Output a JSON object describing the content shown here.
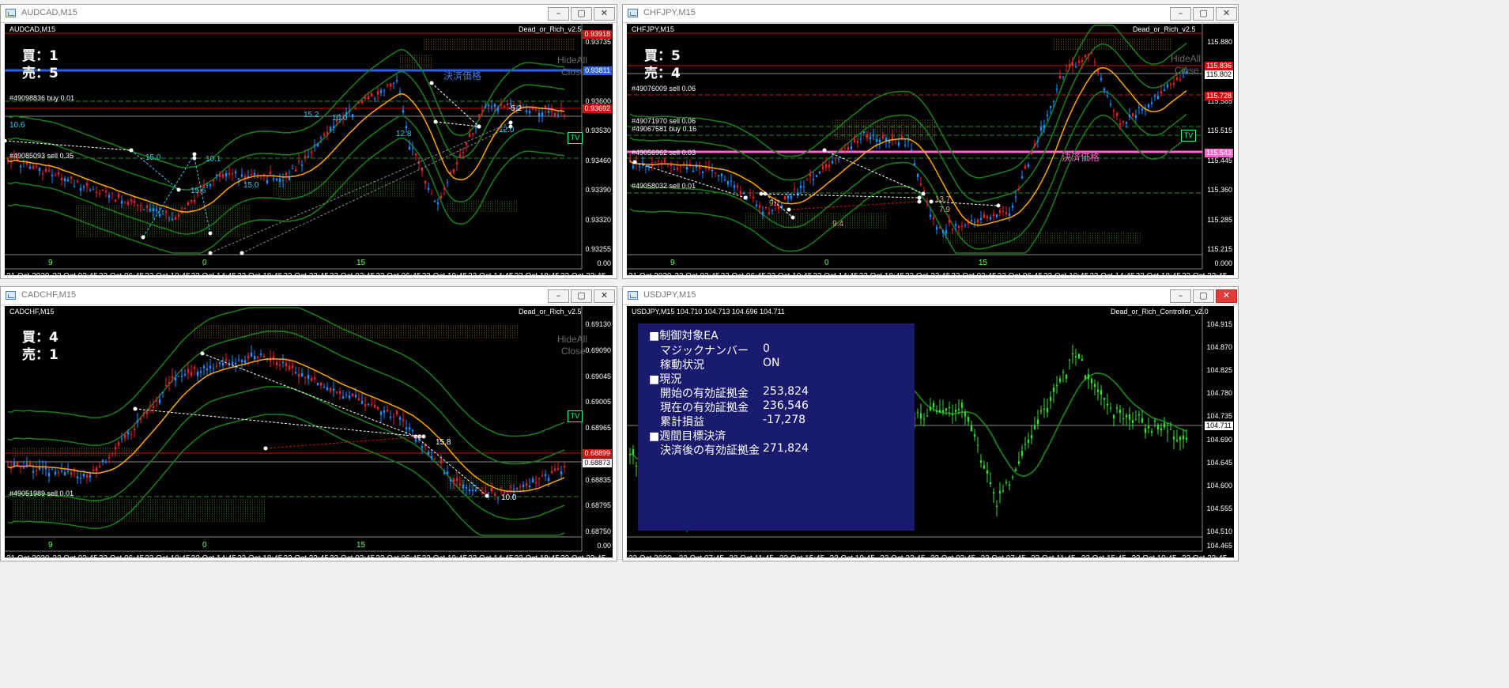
{
  "windows": [
    {
      "title": "AUDCAD,M15",
      "symbol_label": "AUDCAD,M15",
      "ea_label": "Dead_or_Rich_v2.5",
      "buy_label": "買：1",
      "sell_label": "売：5",
      "hideall": "HideAll",
      "close": "Close",
      "tv": "TV",
      "settle_label": "決済価格",
      "orders": [
        "#49098836 buy 0.01",
        "#49085093 sell 0.35"
      ],
      "prices": [
        "0.93735",
        "0.93670",
        "0.93600",
        "0.93530",
        "0.93460",
        "0.93390",
        "0.93320",
        "0.93255",
        "0.00"
      ],
      "price_boxes": [
        "0.93918",
        "0.93811",
        "0.93692"
      ],
      "time_labels": [
        "21 Oct 2020",
        "22 Oct 02:45",
        "22 Oct 06:45",
        "22 Oct 10:45",
        "22 Oct 14:45",
        "22 Oct 18:45",
        "22 Oct 22:45",
        "23 Oct 02:45",
        "23 Oct 06:45",
        "23 Oct 10:45",
        "23 Oct 14:45",
        "23 Oct 18:45",
        "23 Oct 22:45"
      ],
      "day_labels": [
        "9",
        "0",
        "15"
      ],
      "tags": [
        "10.6",
        "15.0",
        "10.1",
        "15.6",
        "15.0",
        "15.2",
        "10.0",
        "12.8",
        "-5.2",
        "12.0"
      ]
    },
    {
      "title": "CHFJPY,M15",
      "symbol_label": "CHFJPY,M15",
      "ea_label": "Dead_or_Rich_v2.5",
      "buy_label": "買：5",
      "sell_label": "売：4",
      "hideall": "HideAll",
      "close": "Close",
      "tv": "TV",
      "settle_label": "決済価格",
      "orders": [
        "#49076009 sell 0.06",
        "#49071970 sell 0.06",
        "#49067581 buy 0.16",
        "#49056962 sell 0.03",
        "#49058032 sell 0.01"
      ],
      "prices": [
        "115.880",
        "115.655",
        "115.585",
        "115.515",
        "115.445",
        "115.360",
        "115.285",
        "115.215",
        "0.000"
      ],
      "price_boxes": [
        "115.836",
        "115.802",
        "115.728",
        "115.543"
      ],
      "time_labels": [
        "21 Oct 2020",
        "22 Oct 02:45",
        "22 Oct 06:45",
        "22 Oct 10:45",
        "22 Oct 14:45",
        "22 Oct 18:45",
        "22 Oct 22:45",
        "23 Oct 02:45",
        "23 Oct 06:45",
        "23 Oct 10:45",
        "23 Oct 14:45",
        "23 Oct 18:45",
        "23 Oct 22:45"
      ],
      "day_labels": [
        "9",
        "0",
        "15"
      ],
      "tags": [
        "9.7",
        "9.4",
        "13.7",
        "7.9"
      ]
    },
    {
      "title": "CADCHF,M15",
      "symbol_label": "CADCHF,M15",
      "ea_label": "Dead_or_Rich_v2.5",
      "buy_label": "買：4",
      "sell_label": "売：1",
      "hideall": "HideAll",
      "close": "Close",
      "tv": "TV",
      "orders": [
        "#49051989 sell 0.01"
      ],
      "prices": [
        "0.69130",
        "0.69090",
        "0.69045",
        "0.69005",
        "0.68965",
        "0.68920",
        "0.68835",
        "0.68795",
        "0.68750",
        "0.00"
      ],
      "price_boxes": [
        "0.68899",
        "0.68873"
      ],
      "time_labels": [
        "21 Oct 2020",
        "22 Oct 02:45",
        "22 Oct 06:45",
        "22 Oct 10:45",
        "22 Oct 14:45",
        "22 Oct 18:45",
        "22 Oct 22:45",
        "23 Oct 02:45",
        "23 Oct 06:45",
        "23 Oct 10:45",
        "23 Oct 14:45",
        "23 Oct 18:45",
        "23 Oct 22:45"
      ],
      "day_labels": [
        "9",
        "0",
        "15"
      ],
      "tags": [
        "15.8",
        "10.0"
      ]
    },
    {
      "title": "USDJPY,M15",
      "symbol_label": "USDJPY,M15  104.710 104.713 104.696 104.711",
      "ea_label": "Dead_or_Rich_Controller_v2.0",
      "prices": [
        "104.915",
        "104.870",
        "104.825",
        "104.780",
        "104.735",
        "104.690",
        "104.645",
        "104.600",
        "104.555",
        "104.510",
        "104.465"
      ],
      "price_boxes": [
        "104.711"
      ],
      "time_labels": [
        "22 Oct 2020",
        "22 Oct 07:45",
        "22 Oct 11:45",
        "22 Oct 15:45",
        "22 Oct 19:45",
        "22 Oct 23:45",
        "23 Oct 03:45",
        "23 Oct 07:45",
        "23 Oct 11:45",
        "23 Oct 15:45",
        "23 Oct 19:45",
        "23 Oct 23:45"
      ],
      "controller": {
        "h1": "■制御対象EA",
        "magic_label": "マジックナンバー",
        "magic_value": "0",
        "status_label": "稼動状況",
        "status_value": "ON",
        "h2": "■現況",
        "start_label": "開始の有効証拠金",
        "start_value": "253,824",
        "current_label": "現在の有効証拠金",
        "current_value": "236,546",
        "pl_label": "累計損益",
        "pl_value": "-17,278",
        "h3": "■週間目標決済",
        "after_label": "決済後の有効証拠金",
        "after_value": "271,824"
      }
    }
  ],
  "colors": {
    "bull": "#1e90ff",
    "bear": "#e8202a",
    "ma": "#ffa500",
    "band": "#1b7a1b",
    "usdjpy_candle": "#3fd63f",
    "settle_line_1": "#3060e0",
    "settle_line_2": "#ff66cc",
    "controller_bg": "#1a1a6e"
  }
}
